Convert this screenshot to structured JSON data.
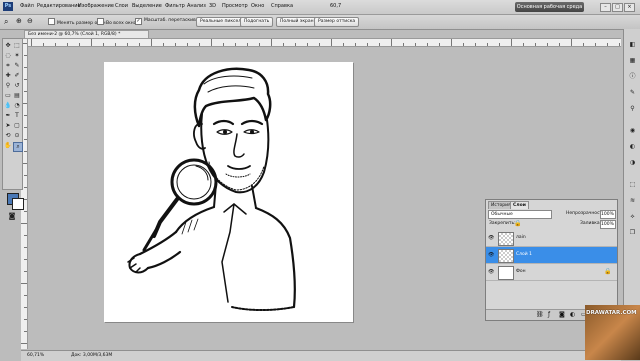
{
  "menu": {
    "logo": "Ps",
    "items": [
      "Файл",
      "Редактирование",
      "Изображение",
      "Слои",
      "Выделение",
      "Фильтр",
      "Анализ",
      "3D",
      "Просмотр",
      "Окно",
      "Справка"
    ],
    "zoom_value": "60,7",
    "workspace_button": "Основная рабочая среда",
    "window_controls": [
      "–",
      "□",
      "×"
    ]
  },
  "options": {
    "checkbox_resize": "Менять размер окон",
    "checkbox_all_windows": "Во всех окнах",
    "checkbox_scrubby": "Масштаб. перетаскиванием",
    "btn_actual_pixels": "Реальные пиксели",
    "btn_fit_screen": "Подогнать",
    "btn_full_screen": "Полный экран",
    "btn_print_size": "Размер оттиска"
  },
  "document": {
    "tab_title": "Без имени-2 @ 60,7% (Слой 1, RGB/8) *"
  },
  "layers_panel": {
    "tab_history": "История",
    "tab_layers": "Слои",
    "blend_mode": "Обычные",
    "opacity_label": "Непрозрачность:",
    "opacity_value": "100%",
    "lock_label": "Закрепить:",
    "fill_label": "Заливка:",
    "fill_value": "100%",
    "layers": [
      {
        "name": "лain",
        "selected": false,
        "transparent": true
      },
      {
        "name": "Слой 1",
        "selected": true,
        "transparent": true
      },
      {
        "name": "Фон",
        "selected": false,
        "transparent": false
      }
    ]
  },
  "status": {
    "zoom": "60,71%",
    "doc_info": "Док: 3,00M/3,63M"
  },
  "watermark": {
    "text": "DRAWATAR.COM"
  },
  "colors": {
    "foreground": "#4a78b5",
    "background": "#ffffff",
    "selected_layer": "#3a8ee8"
  }
}
